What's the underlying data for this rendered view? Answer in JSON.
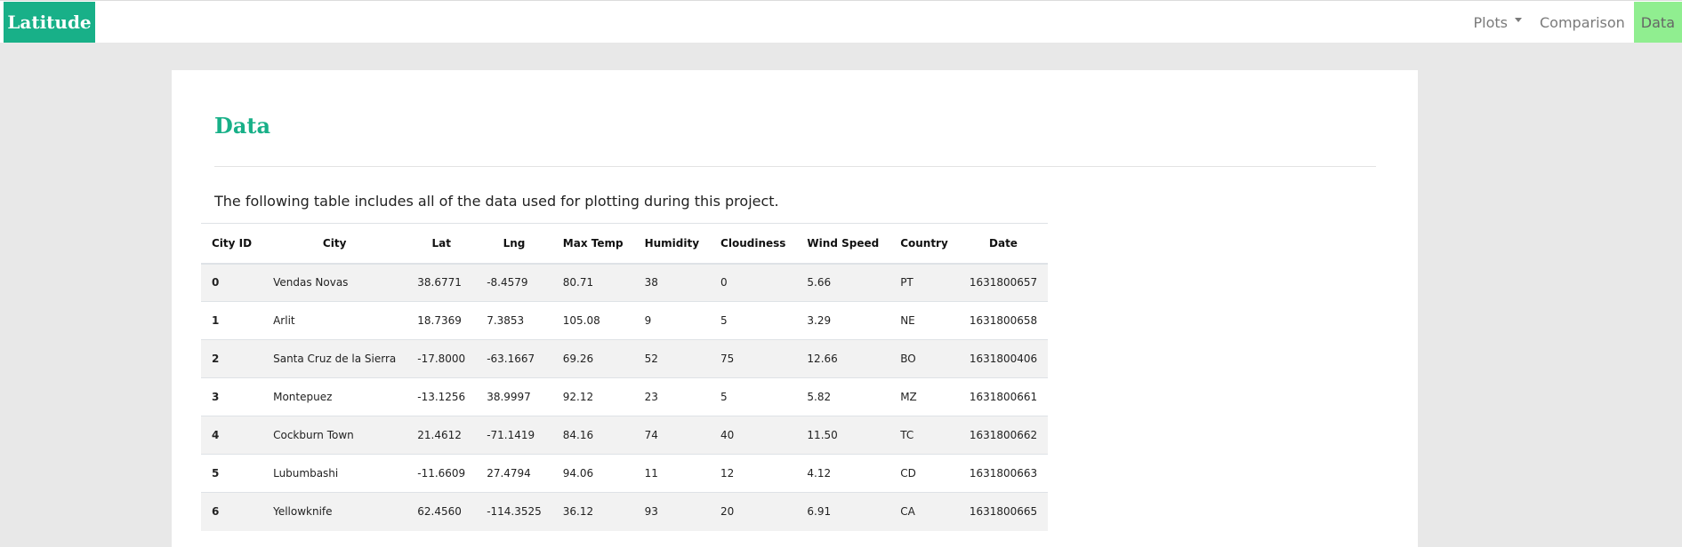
{
  "navbar": {
    "brand": "Latitude",
    "links": [
      {
        "label": "Plots",
        "dropdown": true
      },
      {
        "label": "Comparison"
      },
      {
        "label": "Data",
        "active": true
      }
    ],
    "accent_color": "#18b088",
    "active_color": "#90ee90"
  },
  "main": {
    "title": "Data",
    "intro": "The following table includes all of the data used for plotting during this project.",
    "table": {
      "columns": [
        "City ID",
        "City",
        "Lat",
        "Lng",
        "Max Temp",
        "Humidity",
        "Cloudiness",
        "Wind Speed",
        "Country",
        "Date"
      ],
      "rows": [
        [
          "0",
          "Vendas Novas",
          "38.6771",
          "-8.4579",
          "80.71",
          "38",
          "0",
          "5.66",
          "PT",
          "1631800657"
        ],
        [
          "1",
          "Arlit",
          "18.7369",
          "7.3853",
          "105.08",
          "9",
          "5",
          "3.29",
          "NE",
          "1631800658"
        ],
        [
          "2",
          "Santa Cruz de la Sierra",
          "-17.8000",
          "-63.1667",
          "69.26",
          "52",
          "75",
          "12.66",
          "BO",
          "1631800406"
        ],
        [
          "3",
          "Montepuez",
          "-13.1256",
          "38.9997",
          "92.12",
          "23",
          "5",
          "5.82",
          "MZ",
          "1631800661"
        ],
        [
          "4",
          "Cockburn Town",
          "21.4612",
          "-71.1419",
          "84.16",
          "74",
          "40",
          "11.50",
          "TC",
          "1631800662"
        ],
        [
          "5",
          "Lubumbashi",
          "-11.6609",
          "27.4794",
          "94.06",
          "11",
          "12",
          "4.12",
          "CD",
          "1631800663"
        ],
        [
          "6",
          "Yellowknife",
          "62.4560",
          "-114.3525",
          "36.12",
          "93",
          "20",
          "6.91",
          "CA",
          "1631800665"
        ]
      ]
    }
  }
}
